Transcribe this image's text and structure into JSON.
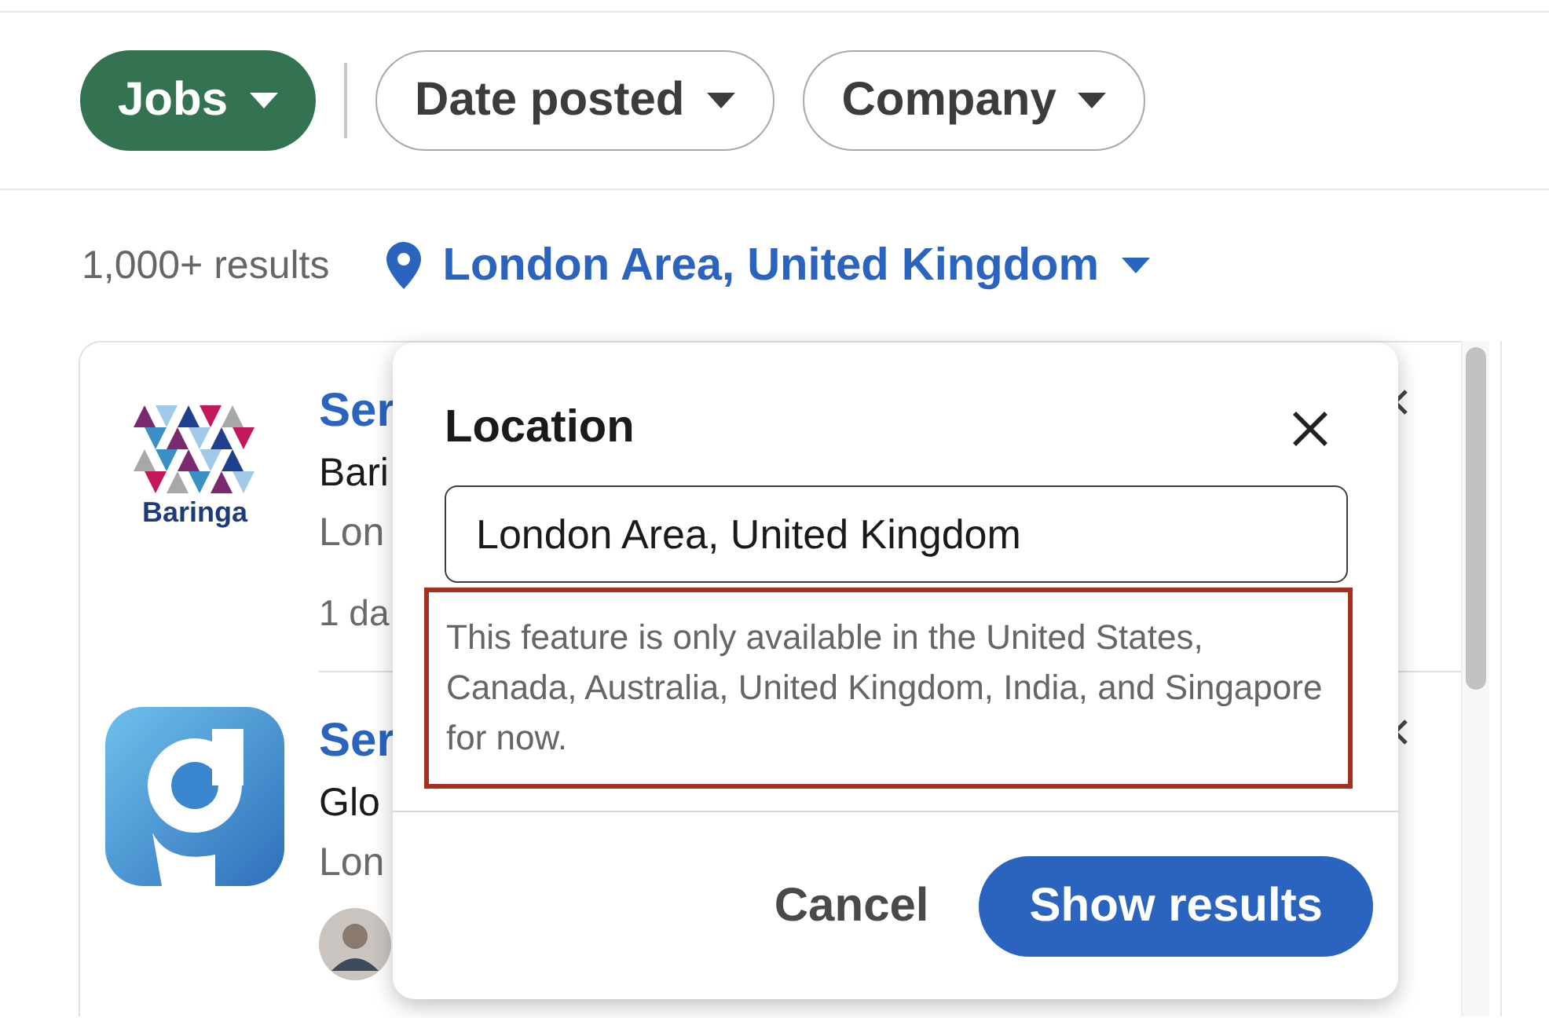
{
  "filters": [
    {
      "label": "Jobs",
      "selected": true
    },
    {
      "label": "Date posted",
      "selected": false
    },
    {
      "label": "Company",
      "selected": false
    }
  ],
  "results": {
    "count": "1,000+ results",
    "location": "London Area, United Kingdom"
  },
  "jobs": [
    {
      "logo": {
        "kind": "baringa",
        "text": "Baringa"
      },
      "title": "Ser",
      "company": "Bari",
      "location": "Lon",
      "footer": {
        "kind": "text",
        "text": "1 da"
      }
    },
    {
      "logo": {
        "kind": "g"
      },
      "title": "Ser",
      "company": "Glo",
      "location": "Lon",
      "footer": {
        "kind": "avatar"
      }
    }
  ],
  "popover": {
    "title": "Location",
    "value": "London Area, United Kingdom",
    "notice": {
      "text": "This feature is only available in the United States, Canada, Australia, United Kingdom, India, and Singapore for now.",
      "highlighted": true
    },
    "buttons": [
      {
        "label": "Cancel",
        "kind": "secondary"
      },
      {
        "label": "Show results",
        "kind": "primary"
      }
    ]
  }
}
